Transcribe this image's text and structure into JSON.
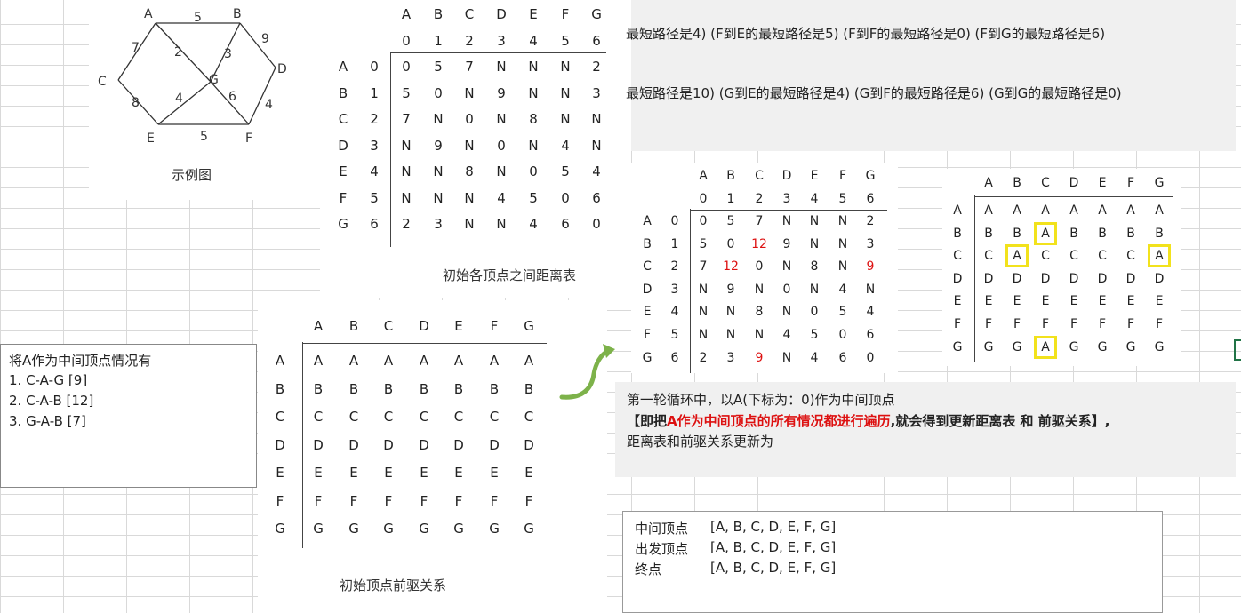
{
  "graph": {
    "nodes": [
      "A",
      "B",
      "C",
      "D",
      "E",
      "F",
      "G"
    ],
    "edges": [
      {
        "from": "A",
        "to": "B",
        "w": "5"
      },
      {
        "from": "A",
        "to": "C",
        "w": "7"
      },
      {
        "from": "A",
        "to": "G",
        "w": "2"
      },
      {
        "from": "B",
        "to": "G",
        "w": "3"
      },
      {
        "from": "B",
        "to": "D",
        "w": "9"
      },
      {
        "from": "C",
        "to": "E",
        "w": "8"
      },
      {
        "from": "E",
        "to": "G",
        "w": "4"
      },
      {
        "from": "G",
        "to": "F",
        "w": "6"
      },
      {
        "from": "E",
        "to": "F",
        "w": "5"
      },
      {
        "from": "D",
        "to": "F",
        "w": "4"
      }
    ],
    "caption": "示例图"
  },
  "dist_init": {
    "headers": [
      "A",
      "B",
      "C",
      "D",
      "E",
      "F",
      "G"
    ],
    "indices": [
      "0",
      "1",
      "2",
      "3",
      "4",
      "5",
      "6"
    ],
    "rows": [
      [
        "0",
        "5",
        "7",
        "N",
        "N",
        "N",
        "2"
      ],
      [
        "5",
        "0",
        "N",
        "9",
        "N",
        "N",
        "3"
      ],
      [
        "7",
        "N",
        "0",
        "N",
        "8",
        "N",
        "N"
      ],
      [
        "N",
        "9",
        "N",
        "0",
        "N",
        "4",
        "N"
      ],
      [
        "N",
        "N",
        "8",
        "N",
        "0",
        "5",
        "4"
      ],
      [
        "N",
        "N",
        "N",
        "4",
        "5",
        "0",
        "6"
      ],
      [
        "2",
        "3",
        "N",
        "N",
        "4",
        "6",
        "0"
      ]
    ],
    "caption": "初始各顶点之间距离表"
  },
  "pre_init": {
    "headers": [
      "A",
      "B",
      "C",
      "D",
      "E",
      "F",
      "G"
    ],
    "rows": [
      [
        "A",
        "A",
        "A",
        "A",
        "A",
        "A",
        "A"
      ],
      [
        "B",
        "B",
        "B",
        "B",
        "B",
        "B",
        "B"
      ],
      [
        "C",
        "C",
        "C",
        "C",
        "C",
        "C",
        "C"
      ],
      [
        "D",
        "D",
        "D",
        "D",
        "D",
        "D",
        "D"
      ],
      [
        "E",
        "E",
        "E",
        "E",
        "E",
        "E",
        "E"
      ],
      [
        "F",
        "F",
        "F",
        "F",
        "F",
        "F",
        "F"
      ],
      [
        "G",
        "G",
        "G",
        "G",
        "G",
        "G",
        "G"
      ]
    ],
    "caption": "初始顶点前驱关系"
  },
  "dist_round1": {
    "headers": [
      "A",
      "B",
      "C",
      "D",
      "E",
      "F",
      "G"
    ],
    "indices": [
      "0",
      "1",
      "2",
      "3",
      "4",
      "5",
      "6"
    ],
    "rows": [
      [
        "0",
        "5",
        "7",
        "N",
        "N",
        "N",
        "2"
      ],
      [
        "5",
        "0",
        "12",
        "9",
        "N",
        "N",
        "3"
      ],
      [
        "7",
        "12",
        "0",
        "N",
        "8",
        "N",
        "9"
      ],
      [
        "N",
        "9",
        "N",
        "0",
        "N",
        "4",
        "N"
      ],
      [
        "N",
        "N",
        "8",
        "N",
        "0",
        "5",
        "4"
      ],
      [
        "N",
        "N",
        "N",
        "4",
        "5",
        "0",
        "6"
      ],
      [
        "2",
        "3",
        "9",
        "N",
        "4",
        "6",
        "0"
      ]
    ]
  },
  "pre_round1": {
    "headers": [
      "A",
      "B",
      "C",
      "D",
      "E",
      "F",
      "G"
    ],
    "rows": [
      [
        "A",
        "A",
        "A",
        "A",
        "A",
        "A",
        "A"
      ],
      [
        "B",
        "B",
        "A",
        "B",
        "B",
        "B",
        "B"
      ],
      [
        "C",
        "A",
        "C",
        "C",
        "C",
        "C",
        "A"
      ],
      [
        "D",
        "D",
        "D",
        "D",
        "D",
        "D",
        "D"
      ],
      [
        "E",
        "E",
        "E",
        "E",
        "E",
        "E",
        "E"
      ],
      [
        "F",
        "F",
        "F",
        "F",
        "F",
        "F",
        "F"
      ],
      [
        "G",
        "G",
        "A",
        "G",
        "G",
        "G",
        "G"
      ]
    ]
  },
  "top_text": {
    "line1": "最短路径是4) (F到E的最短路径是5) (F到F的最短路径是0) (F到G的最短路径是6)",
    "line2": "最短路径是10) (G到E的最短路径是4) (G到F的最短路径是6) (G到G的最短路径是0)"
  },
  "mid_note": {
    "title": "将A作为中间顶点情况有",
    "items": [
      "1. C-A-G [9]",
      "2. C-A-B [12]",
      "3. G-A-B [7]"
    ]
  },
  "explain": {
    "line1": "第一轮循环中，以A(下标为：0)作为中间顶点",
    "line2_a": "【即把",
    "line2_b": "A作为中间顶点的所有情况都进行遍历",
    "line2_c": ",就会得到更新距离表 和 前驱关系】,",
    "line3": "距离表和前驱关系更新为"
  },
  "vertex_box": {
    "rows": [
      {
        "label": "中间顶点",
        "value": "[A, B, C, D, E, F, G]"
      },
      {
        "label": "出发顶点",
        "value": "[A, B, C, D, E, F, G]"
      },
      {
        "label": "终点",
        "value": "[A, B, C, D, E, F, G]"
      }
    ]
  },
  "colors": {
    "highlight": "#f2e21c",
    "changed": "#d11111",
    "arrow": "#7db24a"
  }
}
